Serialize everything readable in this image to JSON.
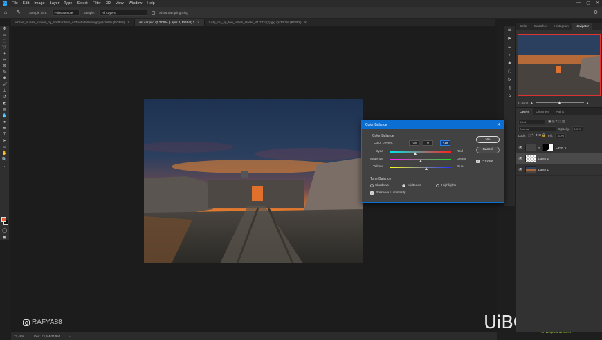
{
  "menu": {
    "items": [
      "File",
      "Edit",
      "Image",
      "Layer",
      "Type",
      "Select",
      "Filter",
      "3D",
      "View",
      "Window",
      "Help"
    ],
    "window_controls": [
      "—",
      "▢",
      "✕"
    ]
  },
  "options": {
    "sample_size_label": "Sample Size:",
    "sample_size_value": "Point Sample",
    "sample_label": "Sample:",
    "sample_value": "All Layers",
    "show_ring_label": "Show Sampling Ring"
  },
  "tabs": [
    {
      "label": "vibrant_sunset_clouds_by_boldfrontiers_da7tw4n fullview.jpg @ 100% (RGB/8)",
      "active": false
    },
    {
      "label": "old car.psd @ 27,8% (Layer 2, RGB/8) *",
      "active": true
    },
    {
      "label": "rusty_car_by_two_ladies_stocks_d1f742q(2).jpg @ 33,3% (RGB/8)",
      "active": false
    }
  ],
  "status": {
    "zoom": "27,48%",
    "doc": "Doc: 13,9M/37,9M"
  },
  "watermark": {
    "instagram": "RAFYA88",
    "site": "UiBQ.CoM",
    "site_url": "www.psahz.com"
  },
  "panels": {
    "top_tabs": [
      "Color",
      "Swatches",
      "Histogram",
      "Navigator"
    ],
    "navigator_zoom": "27,83%",
    "layer_tabs": [
      "Layers",
      "Channels",
      "Paths"
    ],
    "kind_label": "Kind",
    "blend_mode": "Normal",
    "opacity_label": "Opacity:",
    "opacity_value": "100%",
    "lock_label": "Lock:",
    "fill_label": "Fill:",
    "fill_value": "100%",
    "layers": [
      {
        "name": "Layer 0",
        "selected": false
      },
      {
        "name": "Layer 2",
        "selected": true
      },
      {
        "name": "Layer 1",
        "selected": false
      }
    ]
  },
  "dialog": {
    "title": "Color Balance",
    "group_color_balance": "Color Balance",
    "color_levels_label": "Color Levels:",
    "levels": [
      "-18",
      "0",
      "+19"
    ],
    "sliders": [
      {
        "left": "Cyan",
        "right": "Red",
        "value": -18
      },
      {
        "left": "Magenta",
        "right": "Green",
        "value": 0
      },
      {
        "left": "Yellow",
        "right": "Blue",
        "value": 19
      }
    ],
    "ok": "OK",
    "cancel": "Cancel",
    "preview_label": "Preview",
    "group_tone_balance": "Tone Balance",
    "tones": [
      "Shadows",
      "Midtones",
      "Highlights"
    ],
    "selected_tone": "Midtones",
    "preserve_label": "Preserve Luminosity"
  },
  "colors": {
    "accent": "#0b6ed3",
    "foreground": "#e15f32",
    "background": "#111111"
  }
}
